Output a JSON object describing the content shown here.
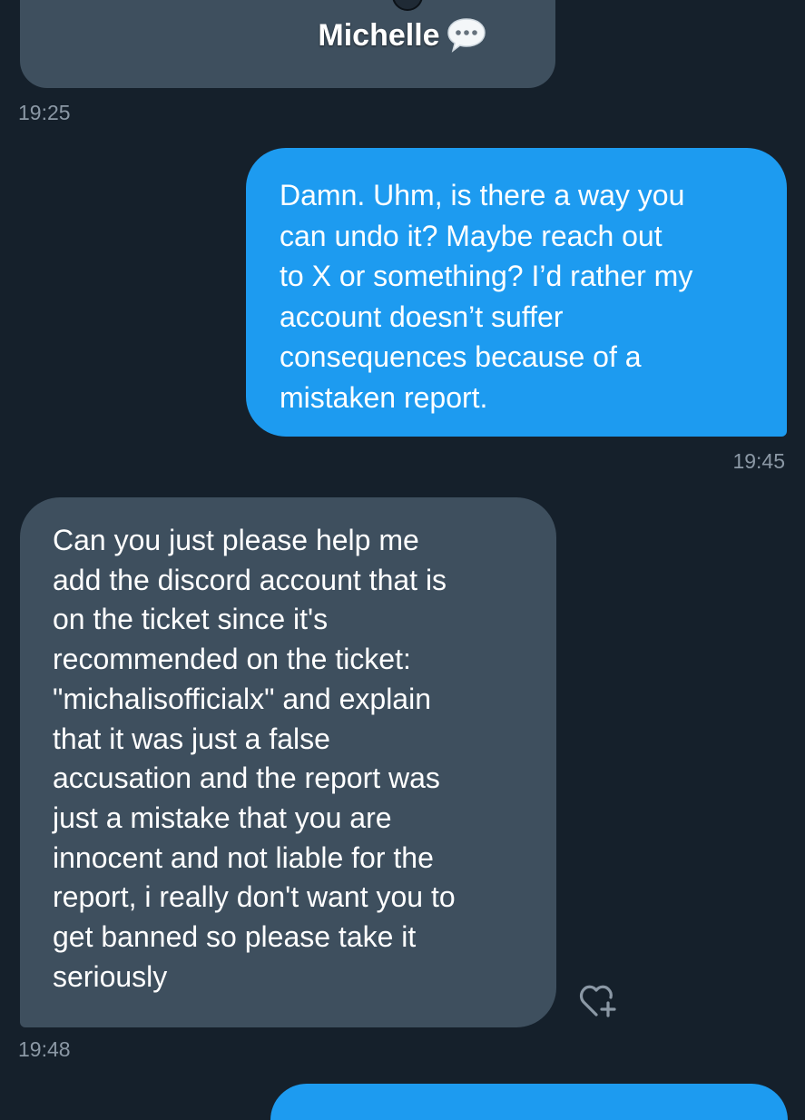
{
  "header": {
    "contact_name": "Michelle",
    "name_emoji_icon": "speech-balloon-icon"
  },
  "messages": [
    {
      "direction": "incoming",
      "text": "",
      "timestamp": "19:25"
    },
    {
      "direction": "outgoing",
      "text": "Damn. Uhm, is there a way you\ncan undo it? Maybe reach out\nto X or something? I’d rather my\naccount doesn’t suffer\nconsequences because of a\nmistaken report.",
      "timestamp": "19:45"
    },
    {
      "direction": "incoming",
      "text": "Can you just please help me\nadd the discord account that is\non the ticket since it's\nrecommended on the ticket:\n\"michalisofficialx\" and explain\nthat it was just a false\naccusation and the report was\njust a mistake that you are\ninnocent and not liable for the\nreport, i really don't want you to\nget banned so please take it\nseriously",
      "timestamp": "19:48",
      "reaction_icon": "heart-plus-icon"
    }
  ],
  "colors": {
    "background": "#15202b",
    "outgoing_bubble": "#1d9bf0",
    "incoming_bubble": "#3e4f5e",
    "timestamp_text": "#8b98a5",
    "message_text": "#ffffff"
  }
}
